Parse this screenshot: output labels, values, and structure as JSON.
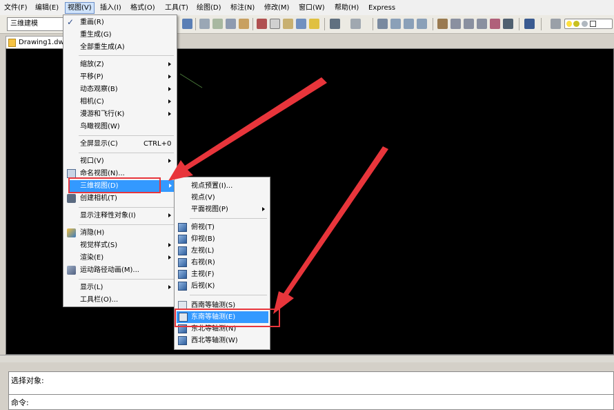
{
  "menubar": {
    "items": [
      {
        "label": "文件(F)"
      },
      {
        "label": "编辑(E)"
      },
      {
        "label": "视图(V)"
      },
      {
        "label": "插入(I)"
      },
      {
        "label": "格式(O)"
      },
      {
        "label": "工具(T)"
      },
      {
        "label": "绘图(D)"
      },
      {
        "label": "标注(N)"
      },
      {
        "label": "修改(M)"
      },
      {
        "label": "窗口(W)"
      },
      {
        "label": "帮助(H)"
      },
      {
        "label": "Express"
      }
    ]
  },
  "toolbar": {
    "workspace": "三维建模"
  },
  "document": {
    "tab_label": "Drawing1.dwg"
  },
  "view_menu": {
    "items": [
      {
        "label": "重画(R)"
      },
      {
        "label": "重生成(G)"
      },
      {
        "label": "全部重生成(A)"
      },
      {
        "label": "缩放(Z)"
      },
      {
        "label": "平移(P)"
      },
      {
        "label": "动态观察(B)"
      },
      {
        "label": "相机(C)"
      },
      {
        "label": "漫游和飞行(K)"
      },
      {
        "label": "鸟瞰视图(W)"
      },
      {
        "label": "全屏显示(C)",
        "shortcut": "CTRL+0"
      },
      {
        "label": "视口(V)"
      },
      {
        "label": "命名视图(N)..."
      },
      {
        "label": "三维视图(D)"
      },
      {
        "label": "创建相机(T)"
      },
      {
        "label": "显示注释性对象(I)"
      },
      {
        "label": "消隐(H)"
      },
      {
        "label": "视觉样式(S)"
      },
      {
        "label": "渲染(E)"
      },
      {
        "label": "运动路径动画(M)..."
      },
      {
        "label": "显示(L)"
      },
      {
        "label": "工具栏(O)..."
      }
    ]
  },
  "view3d_menu": {
    "items": [
      {
        "label": "视点预置(I)..."
      },
      {
        "label": "视点(V)"
      },
      {
        "label": "平面视图(P)"
      },
      {
        "label": "俯视(T)"
      },
      {
        "label": "仰视(B)"
      },
      {
        "label": "左视(L)"
      },
      {
        "label": "右视(R)"
      },
      {
        "label": "主视(F)"
      },
      {
        "label": "后视(K)"
      },
      {
        "label": "西南等轴测(S)"
      },
      {
        "label": "东南等轴测(E)"
      },
      {
        "label": "东北等轴测(N)"
      },
      {
        "label": "西北等轴测(W)"
      }
    ]
  },
  "command": {
    "line1": "选择对象:",
    "line2": "命令:"
  },
  "colors": {
    "highlight": "#3399ff",
    "annotation": "#e8353b",
    "canvas": "#000000"
  }
}
